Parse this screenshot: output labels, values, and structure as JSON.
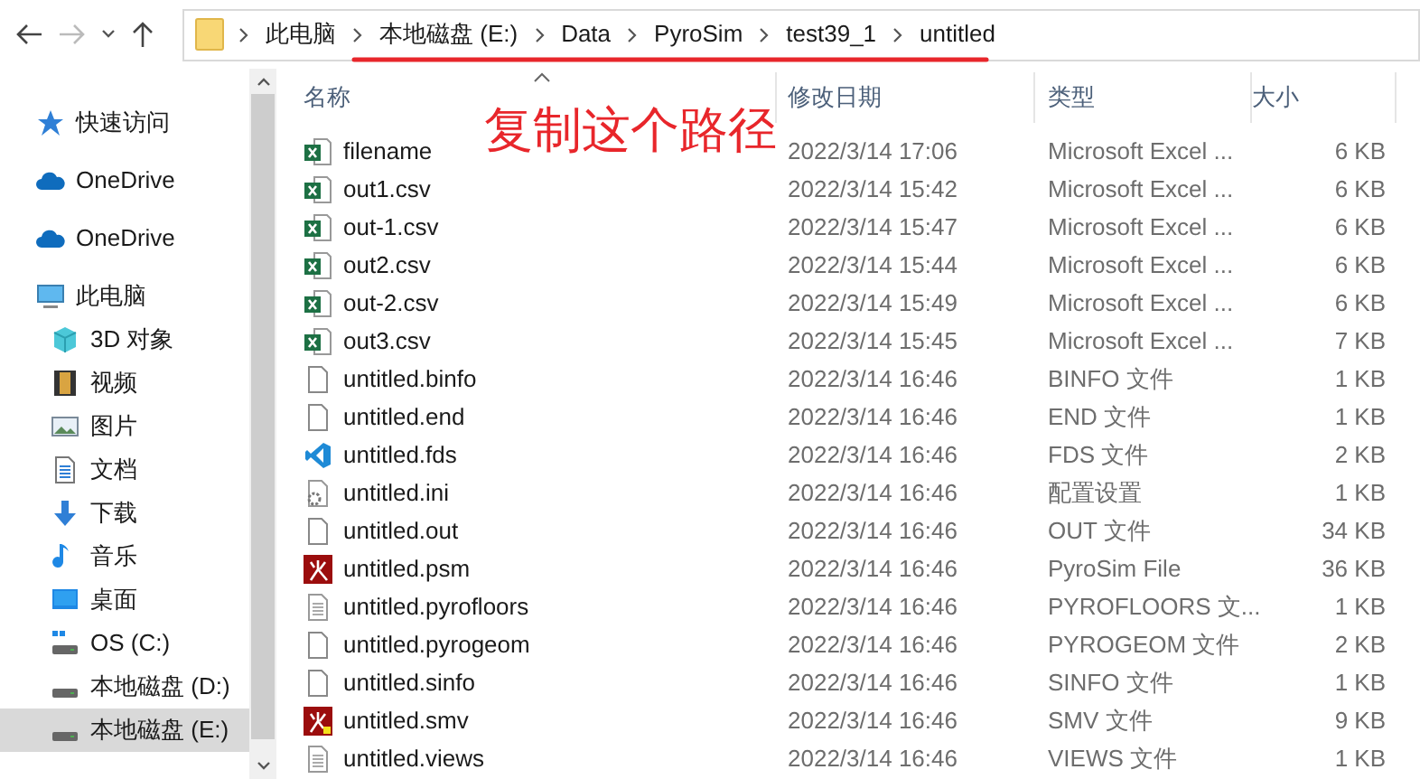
{
  "address": {
    "segments": [
      "此电脑",
      "本地磁盘 (E:)",
      "Data",
      "PyroSim",
      "test39_1",
      "untitled"
    ]
  },
  "nav": {
    "back_disabled": false,
    "forward_disabled": true
  },
  "sidebar": {
    "items": [
      {
        "label": "快速访问",
        "kind": "star",
        "selected": false
      },
      {
        "label": "OneDrive",
        "kind": "cloud",
        "selected": false
      },
      {
        "label": "OneDrive",
        "kind": "cloud",
        "selected": false
      },
      {
        "label": "此电脑",
        "kind": "pc",
        "selected": false,
        "children": [
          {
            "label": "3D 对象",
            "kind": "cube",
            "selected": false
          },
          {
            "label": "视频",
            "kind": "video",
            "selected": false
          },
          {
            "label": "图片",
            "kind": "image",
            "selected": false
          },
          {
            "label": "文档",
            "kind": "doc",
            "selected": false
          },
          {
            "label": "下载",
            "kind": "download",
            "selected": false
          },
          {
            "label": "音乐",
            "kind": "music",
            "selected": false
          },
          {
            "label": "桌面",
            "kind": "desktop",
            "selected": false
          },
          {
            "label": "OS (C:)",
            "kind": "osdrive",
            "selected": false
          },
          {
            "label": "本地磁盘 (D:)",
            "kind": "drive",
            "selected": false
          },
          {
            "label": "本地磁盘 (E:)",
            "kind": "drive",
            "selected": true
          }
        ]
      }
    ]
  },
  "table": {
    "columns": [
      "名称",
      "修改日期",
      "类型",
      "大小"
    ],
    "rows": [
      {
        "name": "filename",
        "date": "2022/3/14 17:06",
        "type": "Microsoft Excel ...",
        "size": "6 KB",
        "kind": "excel"
      },
      {
        "name": "out1.csv",
        "date": "2022/3/14 15:42",
        "type": "Microsoft Excel ...",
        "size": "6 KB",
        "kind": "excel"
      },
      {
        "name": "out-1.csv",
        "date": "2022/3/14 15:47",
        "type": "Microsoft Excel ...",
        "size": "6 KB",
        "kind": "excel"
      },
      {
        "name": "out2.csv",
        "date": "2022/3/14 15:44",
        "type": "Microsoft Excel ...",
        "size": "6 KB",
        "kind": "excel"
      },
      {
        "name": "out-2.csv",
        "date": "2022/3/14 15:49",
        "type": "Microsoft Excel ...",
        "size": "6 KB",
        "kind": "excel"
      },
      {
        "name": "out3.csv",
        "date": "2022/3/14 15:45",
        "type": "Microsoft Excel ...",
        "size": "7 KB",
        "kind": "excel"
      },
      {
        "name": "untitled.binfo",
        "date": "2022/3/14 16:46",
        "type": "BINFO 文件",
        "size": "1 KB",
        "kind": "blank"
      },
      {
        "name": "untitled.end",
        "date": "2022/3/14 16:46",
        "type": "END 文件",
        "size": "1 KB",
        "kind": "blank"
      },
      {
        "name": "untitled.fds",
        "date": "2022/3/14 16:46",
        "type": "FDS 文件",
        "size": "2 KB",
        "kind": "code"
      },
      {
        "name": "untitled.ini",
        "date": "2022/3/14 16:46",
        "type": "配置设置",
        "size": "1 KB",
        "kind": "ini"
      },
      {
        "name": "untitled.out",
        "date": "2022/3/14 16:46",
        "type": "OUT 文件",
        "size": "34 KB",
        "kind": "blank"
      },
      {
        "name": "untitled.psm",
        "date": "2022/3/14 16:46",
        "type": "PyroSim File",
        "size": "36 KB",
        "kind": "pyrosim"
      },
      {
        "name": "untitled.pyrofloors",
        "date": "2022/3/14 16:46",
        "type": "PYROFLOORS 文...",
        "size": "1 KB",
        "kind": "text"
      },
      {
        "name": "untitled.pyrogeom",
        "date": "2022/3/14 16:46",
        "type": "PYROGEOM 文件",
        "size": "2 KB",
        "kind": "blank"
      },
      {
        "name": "untitled.sinfo",
        "date": "2022/3/14 16:46",
        "type": "SINFO 文件",
        "size": "1 KB",
        "kind": "blank"
      },
      {
        "name": "untitled.smv",
        "date": "2022/3/14 16:46",
        "type": "SMV 文件",
        "size": "9 KB",
        "kind": "smv"
      },
      {
        "name": "untitled.views",
        "date": "2022/3/14 16:46",
        "type": "VIEWS 文件",
        "size": "1 KB",
        "kind": "text"
      }
    ]
  },
  "annotation": {
    "text": "复制这个路径"
  }
}
